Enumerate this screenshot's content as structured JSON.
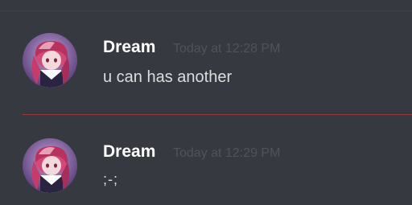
{
  "messages": [
    {
      "author": "Dream",
      "timestamp": "Today at 12:28 PM",
      "text": "u can has another",
      "avatar_icon": "anime-avatar-icon"
    },
    {
      "author": "Dream",
      "timestamp": "Today at 12:29 PM",
      "text": ";-;",
      "avatar_icon": "anime-avatar-icon"
    }
  ],
  "colors": {
    "background": "#36393f",
    "username": "#ffffff",
    "timestamp": "#4f535b",
    "message_text": "#dcddde",
    "new_messages_divider": "#8f3a3c"
  }
}
